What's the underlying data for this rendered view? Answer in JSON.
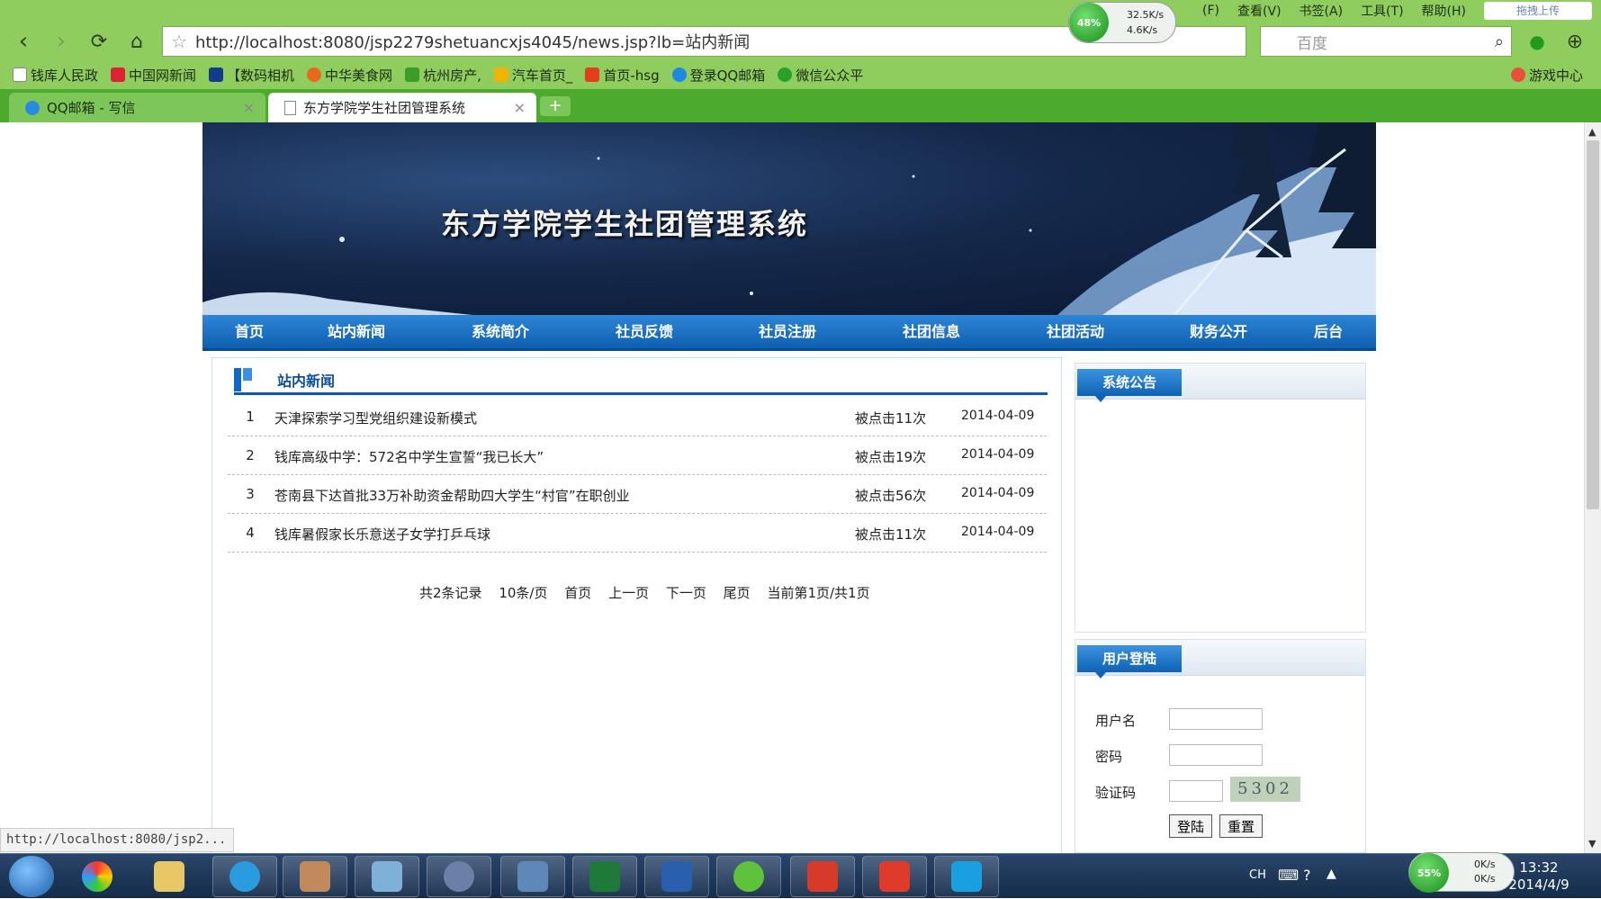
{
  "browser": {
    "menu": [
      "(F)",
      "查看(V)",
      "书签(A)",
      "工具(T)",
      "帮助(H)"
    ],
    "url": "http://localhost:8080/jsp2279shetuancxjs4045/news.jsp?lb=站内新闻",
    "search_placeholder": "百度",
    "cloud_label": "拖拽上传",
    "speed_top": {
      "percent": "48%",
      "up": "32.5K/s",
      "down": "4.6K/s"
    },
    "bookmarks": [
      "钱库人民政",
      "中国网新闻",
      "【数码相机",
      "中华美食网",
      "杭州房产,",
      "汽车首页_",
      "首页-hsg",
      "登录QQ邮箱",
      "微信公众平"
    ],
    "game_center": "游戏中心",
    "tabs": [
      {
        "label": "QQ邮箱 - 写信"
      },
      {
        "label": "东方学院学生社团管理系统"
      }
    ],
    "status_url": "http://localhost:8080/jsp2..."
  },
  "site": {
    "title": "东方学院学生社团管理系统",
    "nav": [
      "首页",
      "站内新闻",
      "系统简介",
      "社员反馈",
      "社员注册",
      "社团信息",
      "社团活动",
      "财务公开",
      "后台"
    ],
    "section_title": "站内新闻",
    "news": [
      {
        "num": "1",
        "title": "天津探索学习型党组织建设新模式",
        "hits": "被点击11次",
        "date": "2014-04-09"
      },
      {
        "num": "2",
        "title": "钱库高级中学：572名中学生宣誓“我已长大”",
        "hits": "被点击19次",
        "date": "2014-04-09"
      },
      {
        "num": "3",
        "title": "苍南县下达首批33万补助资金帮助四大学生“村官”在职创业",
        "hits": "被点击56次",
        "date": "2014-04-09"
      },
      {
        "num": "4",
        "title": "钱库暑假家长乐意送子女学打乒乓球",
        "hits": "被点击11次",
        "date": "2014-04-09"
      }
    ],
    "pager": [
      "共2条记录",
      "10条/页",
      "首页",
      "上一页",
      "下一页",
      "尾页",
      "当前第1页/共1页"
    ],
    "notice_title": "系统公告",
    "login": {
      "title": "用户登陆",
      "user_label": "用户名",
      "pass_label": "密码",
      "code_label": "验证码",
      "captcha": "5302",
      "login_btn": "登陆",
      "reset_btn": "重置"
    }
  },
  "taskbar": {
    "speed": {
      "percent": "55%",
      "up": "0K/s",
      "down": "0K/s"
    },
    "ime": "CH",
    "time": "13:32",
    "date": "2014/4/9"
  },
  "colors": {
    "chrome_green": "#8fce5e",
    "tab_green": "#4caa2e",
    "nav_blue": "#0f5fb1",
    "taskbar": "#1d3657"
  }
}
